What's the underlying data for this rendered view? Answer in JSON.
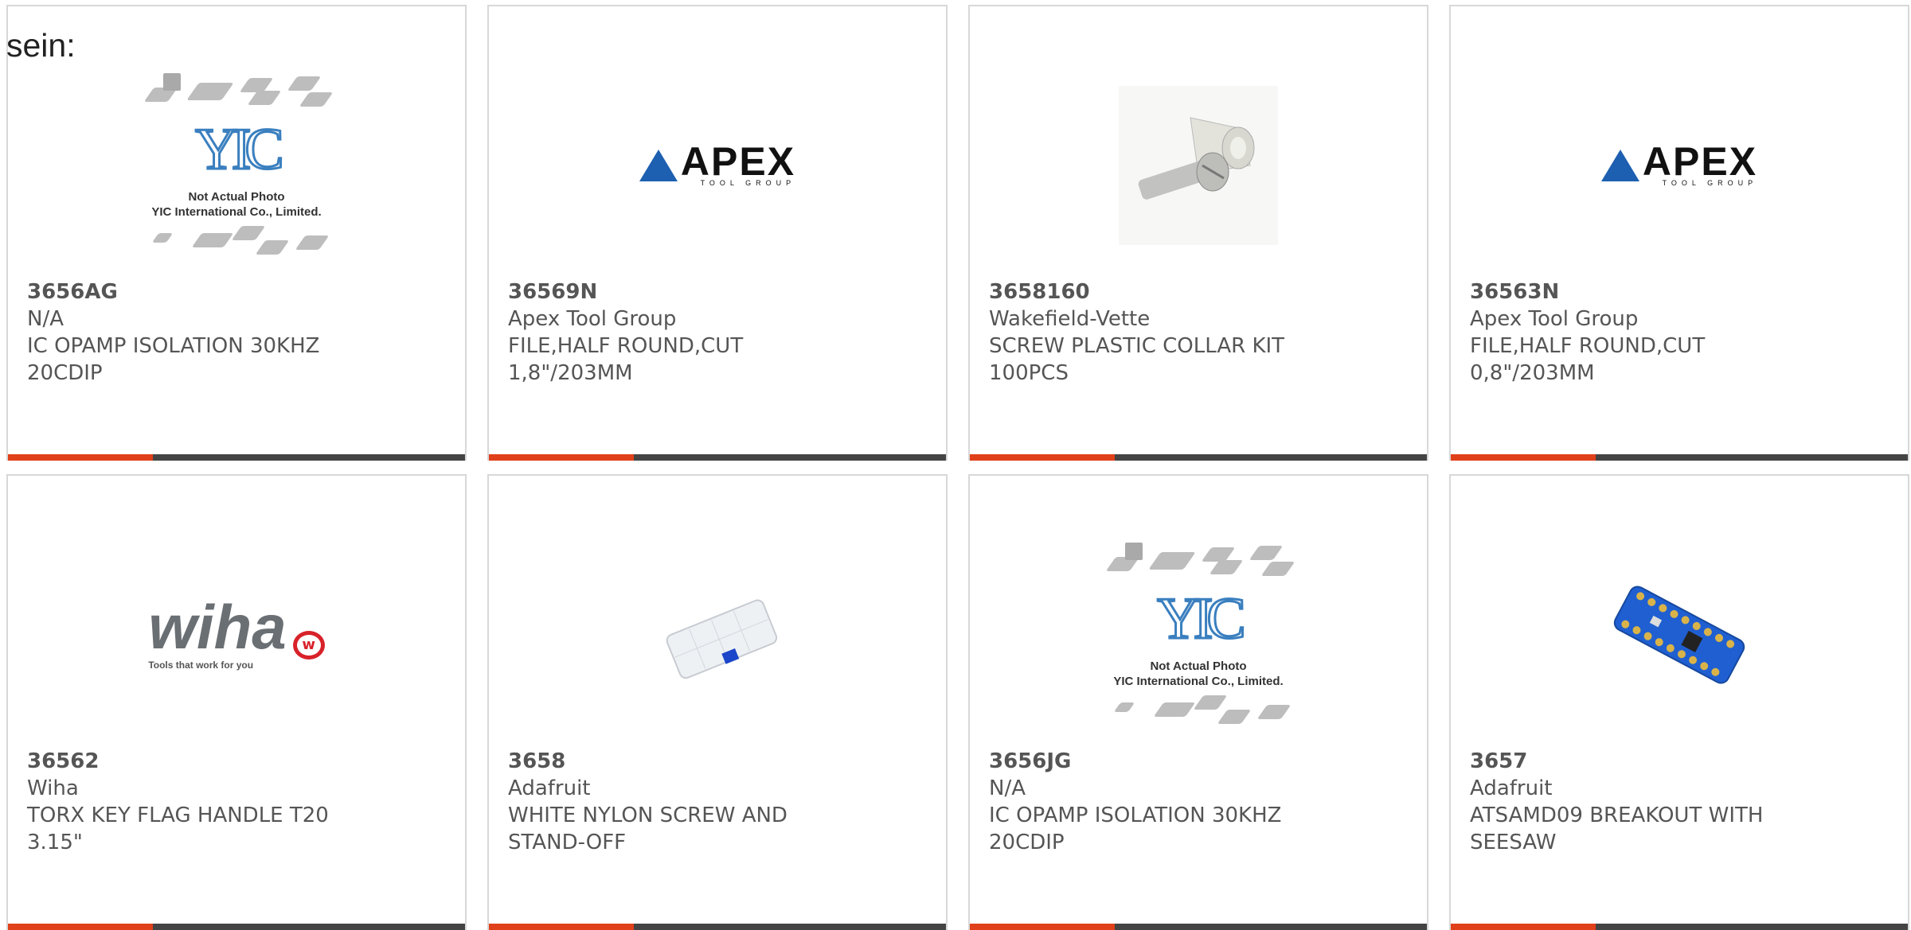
{
  "intro_text": "sein:",
  "cards": [
    {
      "part": "3656AG",
      "mfr": "N/A",
      "desc": "IC OPAMP ISOLATION 30KHZ\n20CDIP",
      "image": "yic-placeholder-icon",
      "placeholder_logo": "YIC",
      "placeholder_note": "Not Actual Photo\nYIC International Co., Limited."
    },
    {
      "part": "36569N",
      "mfr": "Apex Tool Group",
      "desc": "FILE,HALF ROUND,CUT\n1,8\"/203MM",
      "image": "apex-logo-icon",
      "logo_text": "APEX",
      "logo_sub": "TOOL GROUP"
    },
    {
      "part": "3658160",
      "mfr": "Wakefield-Vette",
      "desc": "SCREW PLASTIC COLLAR KIT\n100PCS",
      "image": "screw-photo"
    },
    {
      "part": "36563N",
      "mfr": "Apex Tool Group",
      "desc": "FILE,HALF ROUND,CUT\n0,8\"/203MM",
      "image": "apex-logo-icon",
      "logo_text": "APEX",
      "logo_sub": "TOOL GROUP"
    },
    {
      "part": "36562",
      "mfr": "Wiha",
      "desc": "TORX KEY FLAG HANDLE T20\n3.15\"",
      "image": "wiha-logo-icon",
      "logo_text": "wiha",
      "logo_tag": "Tools that work for you"
    },
    {
      "part": "3658",
      "mfr": "Adafruit",
      "desc": "WHITE NYLON SCREW AND\nSTAND-OFF",
      "image": "nylon-kit-photo"
    },
    {
      "part": "3656JG",
      "mfr": "N/A",
      "desc": "IC OPAMP ISOLATION 30KHZ\n20CDIP",
      "image": "yic-placeholder-icon",
      "placeholder_logo": "YIC",
      "placeholder_note": "Not Actual Photo\nYIC International Co., Limited."
    },
    {
      "part": "3657",
      "mfr": "Adafruit",
      "desc": "ATSAMD09 BREAKOUT WITH\nSEESAW",
      "image": "breakout-board-photo"
    }
  ],
  "colors": {
    "accent": "#e0401a",
    "bar": "#444444",
    "border": "#d8d8d8",
    "text": "#555555"
  }
}
